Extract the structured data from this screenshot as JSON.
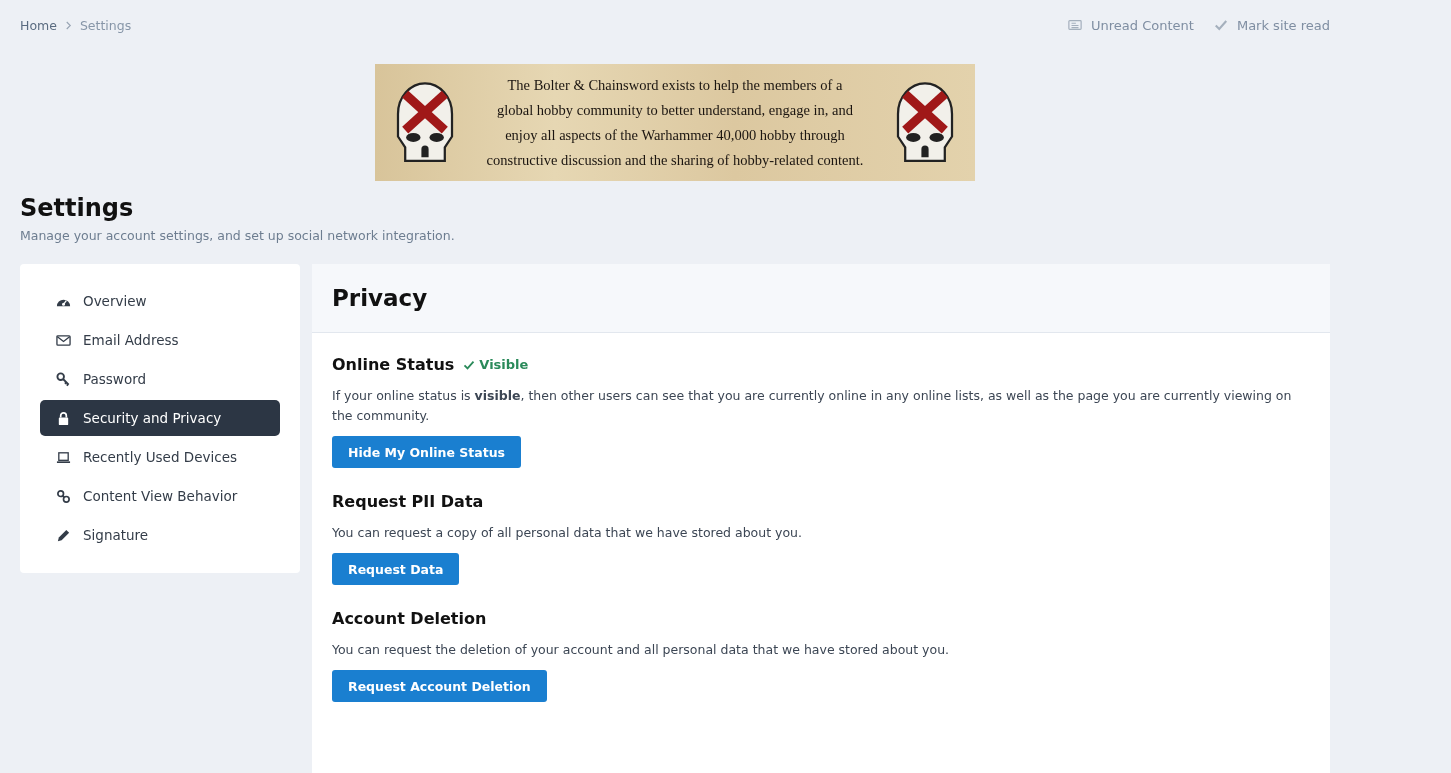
{
  "breadcrumb": [
    {
      "label": "Home",
      "current": false
    },
    {
      "label": "Settings",
      "current": true
    }
  ],
  "top_links": [
    {
      "label": "Unread Content"
    },
    {
      "label": "Mark site read"
    }
  ],
  "banner": {
    "lines": [
      "The Bolter & Chainsword exists to help the members of a",
      "global hobby community to better understand, engage in, and",
      "enjoy all aspects of the Warhammer 40,000 hobby through",
      "constructive discussion and the sharing of hobby-related content."
    ]
  },
  "page": {
    "title": "Settings",
    "subtitle": "Manage your account settings, and set up social network integration."
  },
  "sidebar": {
    "items": [
      {
        "label": "Overview",
        "selected": false
      },
      {
        "label": "Email Address",
        "selected": false
      },
      {
        "label": "Password",
        "selected": false
      },
      {
        "label": "Security and Privacy",
        "selected": true
      },
      {
        "label": "Recently Used Devices",
        "selected": false
      },
      {
        "label": "Content View Behavior",
        "selected": false
      },
      {
        "label": "Signature",
        "selected": false
      }
    ]
  },
  "panel": {
    "title": "Privacy",
    "sections": [
      {
        "title": "Online Status",
        "status": "Visible",
        "text": "If your online status is **visible**, then other users can see that you are currently online in any online lists, as well as the page you are currently viewing on the community.",
        "button": "Hide My Online Status"
      },
      {
        "title": "Request PII Data",
        "text": "You can request a copy of all personal data that we have stored about you.",
        "button": "Request Data"
      },
      {
        "title": "Account Deletion",
        "text": "You can request the deletion of your account and all personal data that we have stored about you.",
        "button": "Request Account Deletion"
      }
    ]
  }
}
